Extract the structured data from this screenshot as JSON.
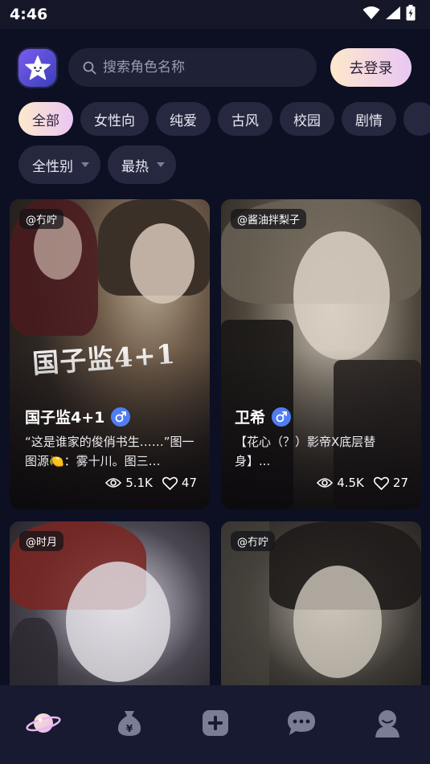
{
  "status_bar": {
    "time": "4:46"
  },
  "header": {
    "search_placeholder": "搜索角色名称",
    "login_label": "去登录"
  },
  "categories": [
    {
      "label": "全部",
      "active": true
    },
    {
      "label": "女性向",
      "active": false
    },
    {
      "label": "纯爱",
      "active": false
    },
    {
      "label": "古风",
      "active": false
    },
    {
      "label": "校园",
      "active": false
    },
    {
      "label": "剧情",
      "active": false
    }
  ],
  "filters": {
    "gender": "全性别",
    "sort": "最热"
  },
  "cards": [
    {
      "author": "@冇咛",
      "name": "国子监4+1",
      "gender": "male",
      "description": "“这是谁家的俊俏书生……”图一图源🍋：雾十川。图三…",
      "views": "5.1K",
      "likes": "47",
      "art_text": "国子监4+1"
    },
    {
      "author": "@酱油拌梨子",
      "name": "卫希",
      "gender": "male",
      "description": "【花心（？）影帝X底层替身】...",
      "views": "4.5K",
      "likes": "27"
    },
    {
      "author": "@时月"
    },
    {
      "author": "@冇咛"
    }
  ],
  "bottom_nav": [
    {
      "icon": "planet-icon",
      "active": true
    },
    {
      "icon": "money-bag-icon",
      "active": false
    },
    {
      "icon": "add-icon",
      "active": false
    },
    {
      "icon": "chat-icon",
      "active": false
    },
    {
      "icon": "profile-icon",
      "active": false
    }
  ],
  "colors": {
    "background": "#0d0f23",
    "accent_gradient_start": "#fde8cc",
    "accent_gradient_end": "#e9c7f4",
    "chip_bg": "#26283f",
    "gender_male": "#4f7df2"
  }
}
